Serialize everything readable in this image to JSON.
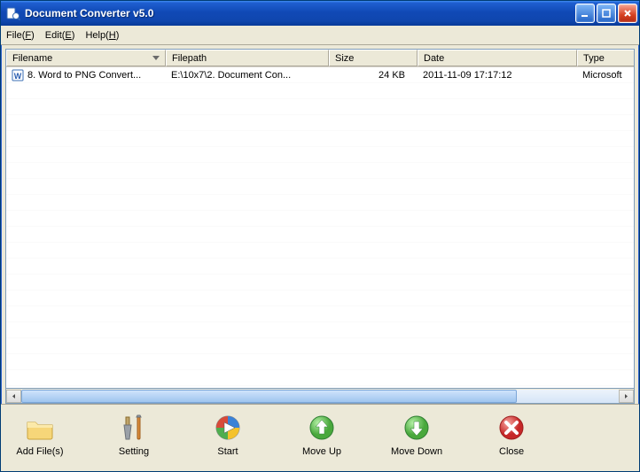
{
  "window": {
    "title": "Document Converter v5.0"
  },
  "menu": {
    "file": {
      "pre": "File(",
      "u": "F",
      "post": ")"
    },
    "edit": {
      "pre": "Edit(",
      "u": "E",
      "post": ")"
    },
    "help": {
      "pre": "Help(",
      "u": "H",
      "post": ")"
    }
  },
  "columns": {
    "filename": "Filename",
    "filepath": "Filepath",
    "size": "Size",
    "date": "Date",
    "type": "Type"
  },
  "rows": [
    {
      "filename": "8. Word to PNG Convert...",
      "filepath": "E:\\10x7\\2. Document Con...",
      "size": "24 KB",
      "date": "2011-11-09 17:17:12",
      "type": "Microsoft"
    }
  ],
  "toolbar": {
    "addfiles": "Add File(s)",
    "setting": "Setting",
    "start": "Start",
    "moveup": "Move Up",
    "movedown": "Move Down",
    "close": "Close"
  }
}
